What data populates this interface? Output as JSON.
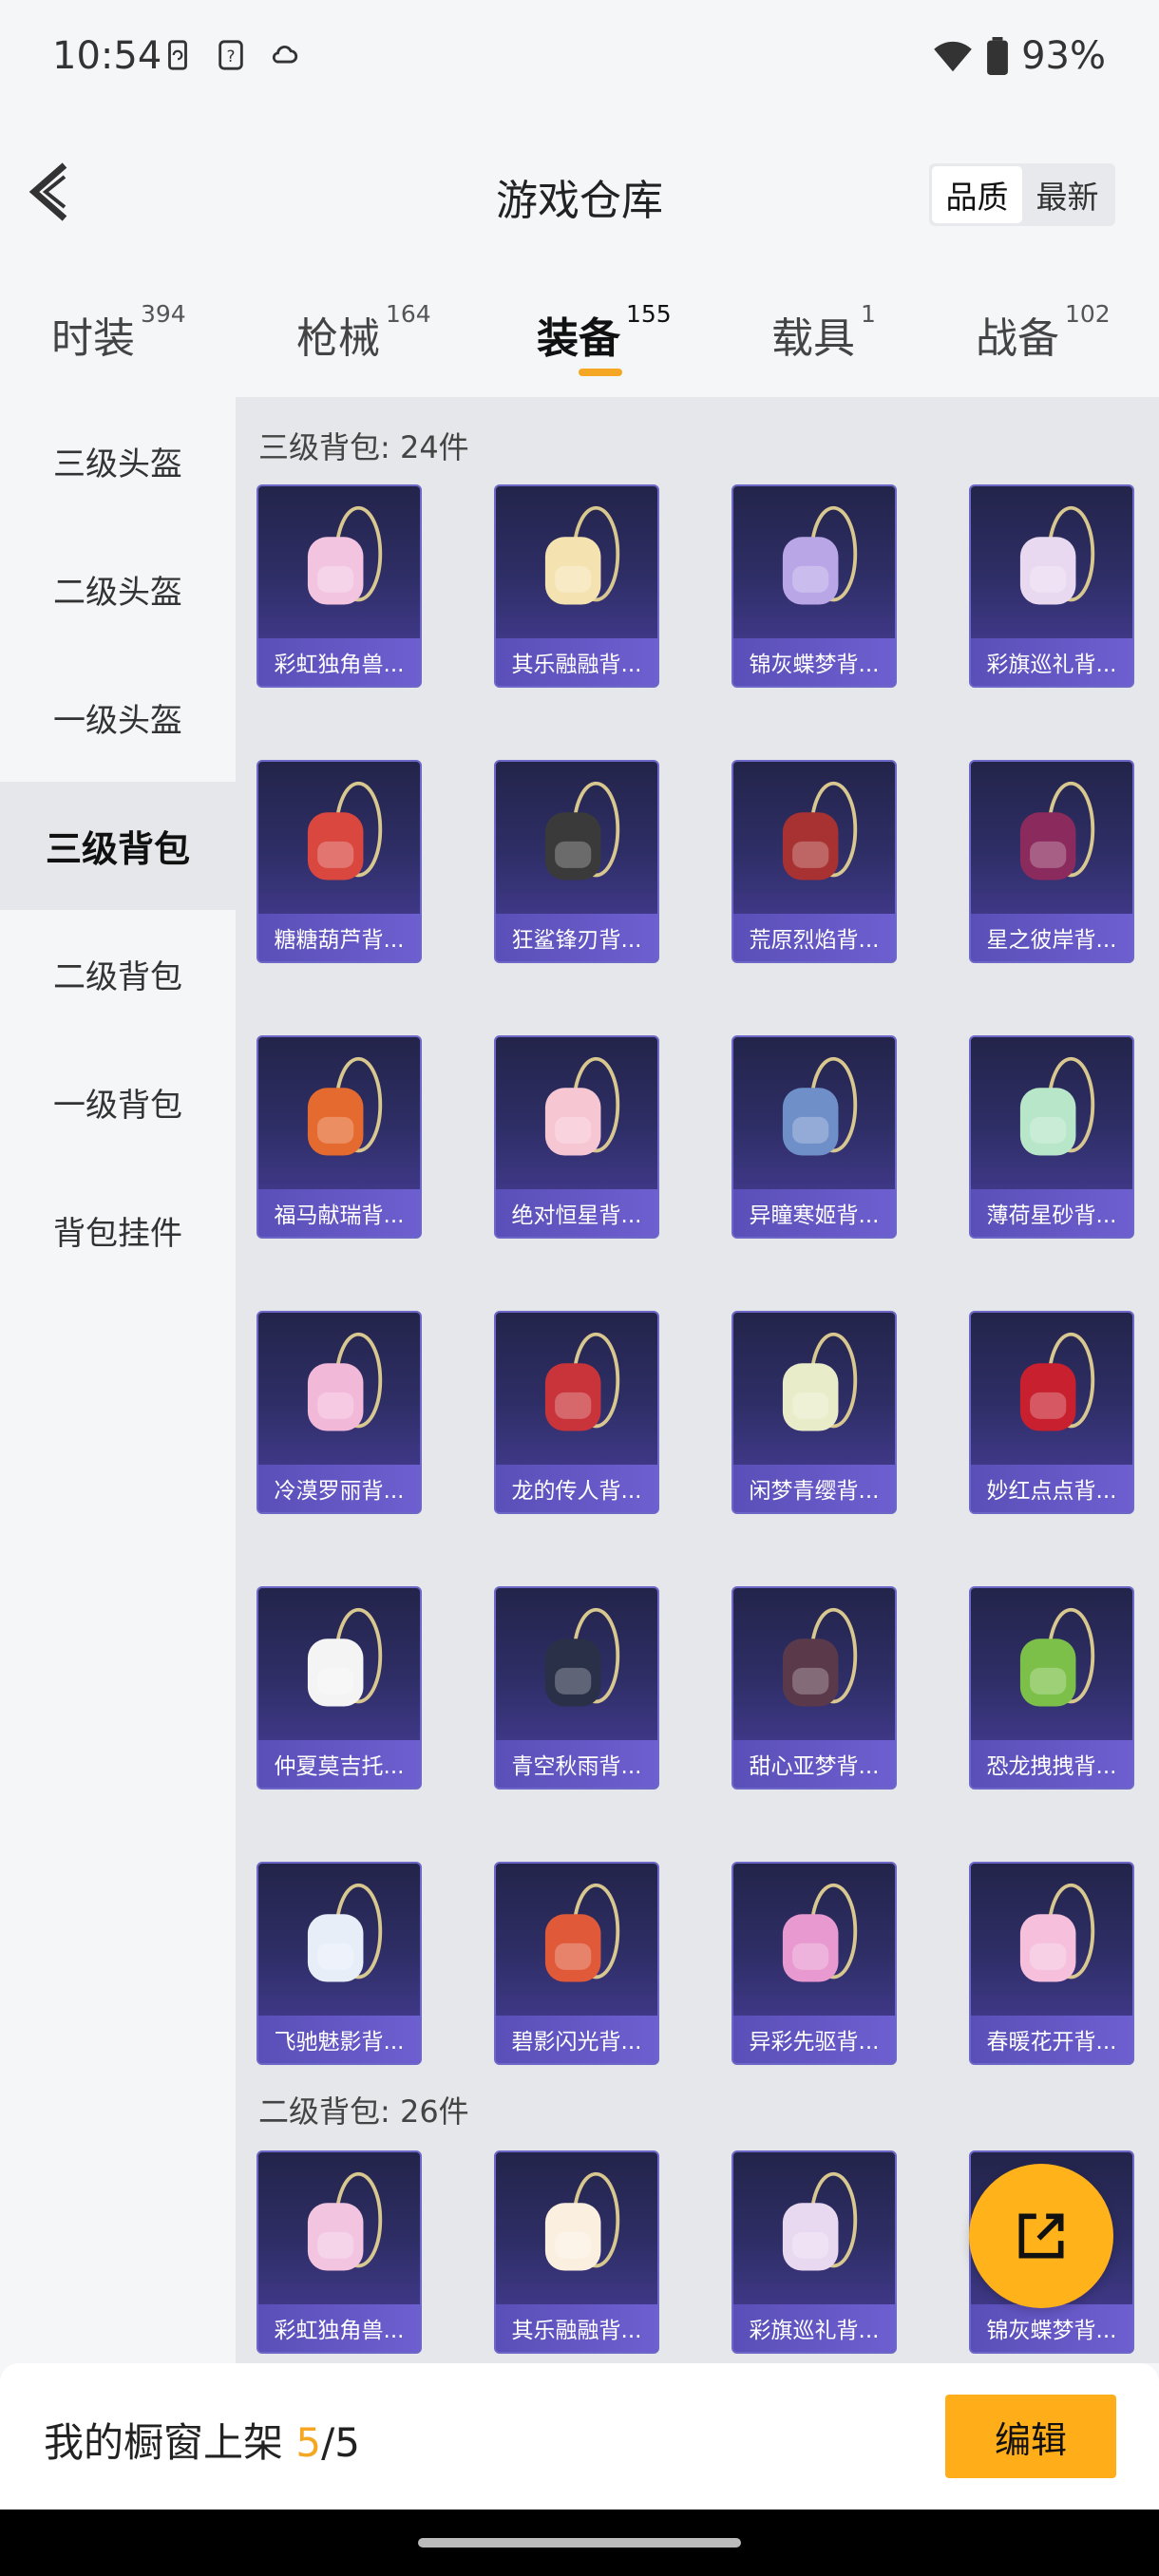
{
  "status_bar": {
    "time": "10:54",
    "battery": "93%",
    "icons": [
      "phone-sync-icon",
      "question-box-icon",
      "cloud-icon"
    ]
  },
  "header": {
    "title": "游戏仓库",
    "sort_options": [
      "品质",
      "最新"
    ],
    "sort_selected": "品质"
  },
  "tabs": [
    {
      "label": "时装",
      "count": "394"
    },
    {
      "label": "枪械",
      "count": "164"
    },
    {
      "label": "装备",
      "count": "155",
      "active": true
    },
    {
      "label": "载具",
      "count": "1"
    },
    {
      "label": "战备",
      "count": "102"
    }
  ],
  "sidebar": {
    "items": [
      "三级头盔",
      "二级头盔",
      "一级头盔",
      "三级背包",
      "二级背包",
      "一级背包",
      "背包挂件"
    ],
    "active": "三级背包"
  },
  "sections": [
    {
      "title": "三级背包: 24件",
      "items": [
        {
          "name": "彩虹独角兽...",
          "color": "#f2c4e0"
        },
        {
          "name": "其乐融融背...",
          "color": "#f4e3b0"
        },
        {
          "name": "锦灰蝶梦背...",
          "color": "#b9a6e6"
        },
        {
          "name": "彩旗巡礼背...",
          "color": "#e8d8f0"
        },
        {
          "name": "糖糖葫芦背...",
          "color": "#d9473f"
        },
        {
          "name": "狂鲨锋刃背...",
          "color": "#3a3a3a"
        },
        {
          "name": "荒原烈焰背...",
          "color": "#a83232"
        },
        {
          "name": "星之彼岸背...",
          "color": "#8b2a5c"
        },
        {
          "name": "福马献瑞背...",
          "color": "#e46a2f"
        },
        {
          "name": "绝对恒星背...",
          "color": "#f7c6d3"
        },
        {
          "name": "异瞳寒姬背...",
          "color": "#6f8fc8"
        },
        {
          "name": "薄荷星砂背...",
          "color": "#b7e6c8"
        },
        {
          "name": "冷漠罗丽背...",
          "color": "#f2b8d8"
        },
        {
          "name": "龙的传人背...",
          "color": "#c9343a"
        },
        {
          "name": "闲梦青缨背...",
          "color": "#e8ecc8"
        },
        {
          "name": "妙红点点背...",
          "color": "#c8202e"
        },
        {
          "name": "仲夏莫吉托...",
          "color": "#f4f4f4"
        },
        {
          "name": "青空秋雨背...",
          "color": "#2a3048"
        },
        {
          "name": "甜心亚梦背...",
          "color": "#5a3a4a"
        },
        {
          "name": "恐龙拽拽背...",
          "color": "#7cc04a"
        },
        {
          "name": "飞驰魅影背...",
          "color": "#e8eef8"
        },
        {
          "name": "碧影闪光背...",
          "color": "#e05a3a"
        },
        {
          "name": "异彩先驱背...",
          "color": "#e89ad0"
        },
        {
          "name": "春暖花开背...",
          "color": "#f6c0dc"
        }
      ]
    },
    {
      "title": "二级背包: 26件",
      "items": [
        {
          "name": "彩虹独角兽...",
          "color": "#f2c4e0"
        },
        {
          "name": "其乐融融背...",
          "color": "#fbf0e0"
        },
        {
          "name": "彩旗巡礼背...",
          "color": "#e8d8f0"
        },
        {
          "name": "锦灰蝶梦背...",
          "color": "#b9a6e6"
        }
      ]
    }
  ],
  "fab": {
    "icon": "share-external-icon"
  },
  "bottom_bar": {
    "prefix": "我的橱窗上架 ",
    "current": "5",
    "total": "/5",
    "edit_label": "编辑"
  },
  "colors": {
    "accent": "#f5a623",
    "card_top": "#23244a",
    "card_bottom": "#4b3f9e",
    "label_bg": "#5a4fb8"
  }
}
